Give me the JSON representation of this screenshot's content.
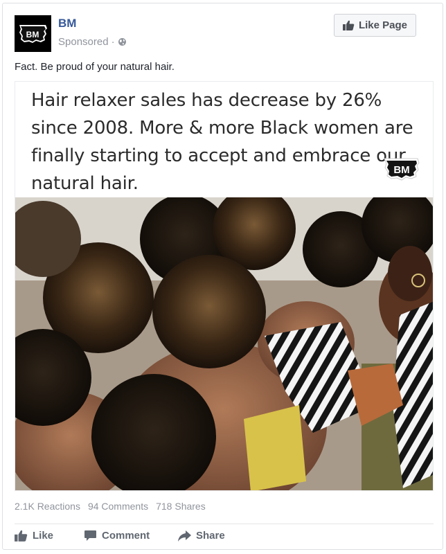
{
  "post": {
    "page_name": "BM",
    "sponsored_label": "Sponsored",
    "separator": "·",
    "like_page_label": "Like Page",
    "text": "Fact. Be proud of your natural hair.",
    "logo_text": "BM"
  },
  "media": {
    "quote_text": "Hair relaxer sales has decrease by 26% since 2008. More & more Black women are finally starting to accept and embrace our natural hair.",
    "logo_text": "BM"
  },
  "stats": {
    "reactions": "2.1K Reactions",
    "comments": "94 Comments",
    "shares": "718 Shares"
  },
  "actions": {
    "like": "Like",
    "comment": "Comment",
    "share": "Share"
  },
  "colors": {
    "link_blue": "#365899",
    "meta_gray": "#90949c",
    "action_gray": "#606770"
  },
  "icons": [
    "globe-icon",
    "thumbs-up-icon",
    "comment-icon",
    "share-arrow-icon"
  ]
}
